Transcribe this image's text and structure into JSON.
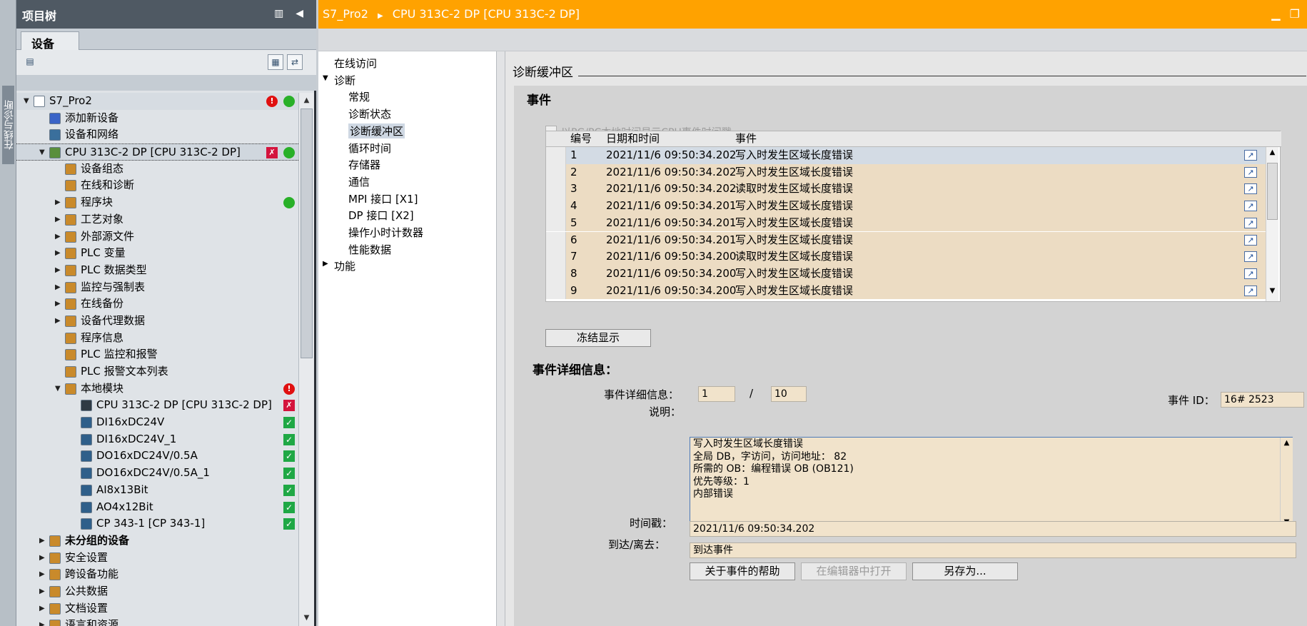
{
  "side_tab": {
    "label": "在线与诊断"
  },
  "tree": {
    "title": "项目树",
    "tab": "设备",
    "items": [
      {
        "label": "S7_Pro2",
        "arrow": "▼",
        "indent": 0,
        "icon": "project-icon",
        "status1": "error",
        "status2": "ok"
      },
      {
        "label": "添加新设备",
        "arrow": "",
        "indent": 1,
        "icon": "add-device-icon"
      },
      {
        "label": "设备和网络",
        "arrow": "",
        "indent": 1,
        "icon": "network-icon"
      },
      {
        "label": "CPU 313C-2 DP [CPU 313C-2 DP]",
        "arrow": "▼",
        "indent": 1,
        "icon": "cpu-icon",
        "status1": "fault-module",
        "status2": "ok",
        "selected": true
      },
      {
        "label": "设备组态",
        "arrow": "",
        "indent": 2,
        "icon": "device-config-icon"
      },
      {
        "label": "在线和诊断",
        "arrow": "",
        "indent": 2,
        "icon": "online-diag-icon"
      },
      {
        "label": "程序块",
        "arrow": "▶",
        "indent": 2,
        "icon": "program-blocks-icon",
        "status2": "ok"
      },
      {
        "label": "工艺对象",
        "arrow": "▶",
        "indent": 2,
        "icon": "tech-objects-icon"
      },
      {
        "label": "外部源文件",
        "arrow": "▶",
        "indent": 2,
        "icon": "source-files-icon"
      },
      {
        "label": "PLC 变量",
        "arrow": "▶",
        "indent": 2,
        "icon": "plc-tags-icon"
      },
      {
        "label": "PLC 数据类型",
        "arrow": "▶",
        "indent": 2,
        "icon": "plc-datatypes-icon"
      },
      {
        "label": "监控与强制表",
        "arrow": "▶",
        "indent": 2,
        "icon": "watch-table-icon"
      },
      {
        "label": "在线备份",
        "arrow": "▶",
        "indent": 2,
        "icon": "online-backup-icon"
      },
      {
        "label": "设备代理数据",
        "arrow": "▶",
        "indent": 2,
        "icon": "proxy-data-icon"
      },
      {
        "label": "程序信息",
        "arrow": "",
        "indent": 2,
        "icon": "program-info-icon"
      },
      {
        "label": "PLC 监控和报警",
        "arrow": "",
        "indent": 2,
        "icon": "plc-alarms-icon"
      },
      {
        "label": "PLC 报警文本列表",
        "arrow": "",
        "indent": 2,
        "icon": "alarm-text-icon"
      },
      {
        "label": "本地模块",
        "arrow": "▼",
        "indent": 2,
        "icon": "local-modules-icon",
        "status2": "error"
      },
      {
        "label": "CPU 313C-2 DP [CPU 313C-2 DP]",
        "arrow": "",
        "indent": 3,
        "icon": "cpu-module-icon",
        "status2": "fault-module"
      },
      {
        "label": "DI16xDC24V",
        "arrow": "",
        "indent": 3,
        "icon": "module-icon",
        "status2": "check"
      },
      {
        "label": "DI16xDC24V_1",
        "arrow": "",
        "indent": 3,
        "icon": "module-icon",
        "status2": "check"
      },
      {
        "label": "DO16xDC24V/0.5A",
        "arrow": "",
        "indent": 3,
        "icon": "module-icon",
        "status2": "check"
      },
      {
        "label": "DO16xDC24V/0.5A_1",
        "arrow": "",
        "indent": 3,
        "icon": "module-icon",
        "status2": "check"
      },
      {
        "label": "AI8x13Bit",
        "arrow": "",
        "indent": 3,
        "icon": "module-icon",
        "status2": "check"
      },
      {
        "label": "AO4x12Bit",
        "arrow": "",
        "indent": 3,
        "icon": "module-icon",
        "status2": "check"
      },
      {
        "label": "CP 343-1 [CP 343-1]",
        "arrow": "",
        "indent": 3,
        "icon": "module-icon",
        "status2": "check"
      },
      {
        "label": "未分组的设备",
        "arrow": "▶",
        "indent": 1,
        "icon": "ungrouped-icon",
        "bold": true
      },
      {
        "label": "安全设置",
        "arrow": "▶",
        "indent": 1,
        "icon": "security-icon"
      },
      {
        "label": "跨设备功能",
        "arrow": "▶",
        "indent": 1,
        "icon": "cross-device-icon"
      },
      {
        "label": "公共数据",
        "arrow": "▶",
        "indent": 1,
        "icon": "common-data-icon"
      },
      {
        "label": "文档设置",
        "arrow": "▶",
        "indent": 1,
        "icon": "doc-settings-icon"
      },
      {
        "label": "语言和资源",
        "arrow": "▶",
        "indent": 1,
        "icon": "languages-icon"
      }
    ]
  },
  "main": {
    "breadcrumb": [
      "S7_Pro2",
      "CPU 313C-2 DP [CPU 313C-2 DP]"
    ],
    "nav": [
      {
        "label": "在线访问",
        "indent": 0,
        "arrow": ""
      },
      {
        "label": "诊断",
        "indent": 0,
        "arrow": "▼"
      },
      {
        "label": "常规",
        "indent": 1,
        "arrow": ""
      },
      {
        "label": "诊断状态",
        "indent": 1,
        "arrow": ""
      },
      {
        "label": "诊断缓冲区",
        "indent": 1,
        "arrow": "",
        "selected": true
      },
      {
        "label": "循环时间",
        "indent": 1,
        "arrow": ""
      },
      {
        "label": "存储器",
        "indent": 1,
        "arrow": ""
      },
      {
        "label": "通信",
        "indent": 1,
        "arrow": ""
      },
      {
        "label": "MPI 接口 [X1]",
        "indent": 1,
        "arrow": ""
      },
      {
        "label": "DP 接口 [X2]",
        "indent": 1,
        "arrow": ""
      },
      {
        "label": "操作小时计数器",
        "indent": 1,
        "arrow": ""
      },
      {
        "label": "性能数据",
        "indent": 1,
        "arrow": ""
      },
      {
        "label": "功能",
        "indent": 0,
        "arrow": "▶"
      }
    ],
    "section_title": "诊断缓冲区",
    "events_title": "事件",
    "local_time_checkbox": "以PG/PC本地时间显示CPU事件时间戳",
    "columns": [
      "编号",
      "日期和时间",
      "事件"
    ],
    "rows": [
      {
        "no": "1",
        "time": "2021/11/6 09:50:34.202",
        "event": "写入时发生区域长度错误"
      },
      {
        "no": "2",
        "time": "2021/11/6 09:50:34.202",
        "event": "写入时发生区域长度错误"
      },
      {
        "no": "3",
        "time": "2021/11/6 09:50:34.202",
        "event": "读取时发生区域长度错误"
      },
      {
        "no": "4",
        "time": "2021/11/6 09:50:34.201",
        "event": "写入时发生区域长度错误"
      },
      {
        "no": "5",
        "time": "2021/11/6 09:50:34.201",
        "event": "写入时发生区域长度错误"
      },
      {
        "no": "6",
        "time": "2021/11/6 09:50:34.201",
        "event": "写入时发生区域长度错误"
      },
      {
        "no": "7",
        "time": "2021/11/6 09:50:34.200",
        "event": "读取时发生区域长度错误"
      },
      {
        "no": "8",
        "time": "2021/11/6 09:50:34.200",
        "event": "写入时发生区域长度错误"
      },
      {
        "no": "9",
        "time": "2021/11/6 09:50:34.200",
        "event": "写入时发生区域长度错误"
      }
    ],
    "freeze_button": "冻结显示",
    "details_title": "事件详细信息：",
    "detail_label": "事件详细信息：",
    "detail_index": "1",
    "detail_sep": "/",
    "detail_total": "10",
    "event_id_label": "事件 ID：",
    "event_id": "16# 2523",
    "description_label": "说明：",
    "description": "写入时发生区域长度错误\n全局 DB，字访问，访问地址：   82\n所需的 OB：编程错误 OB (OB121)\n优先等级：1\n内部错误",
    "timestamp_label": "时间戳：",
    "timestamp": "2021/11/6 09:50:34.202",
    "arrive_label": "到达/离去：",
    "arrive": "到达事件",
    "help_button": "关于事件的帮助",
    "open_editor_button": "在编辑器中打开",
    "save_as_button": "另存为..."
  },
  "colors": {
    "accent": "#ffa200",
    "tree_header": "#4f5963",
    "row_fill": "#ecdcc3",
    "field_fill": "#f1e3cb"
  }
}
